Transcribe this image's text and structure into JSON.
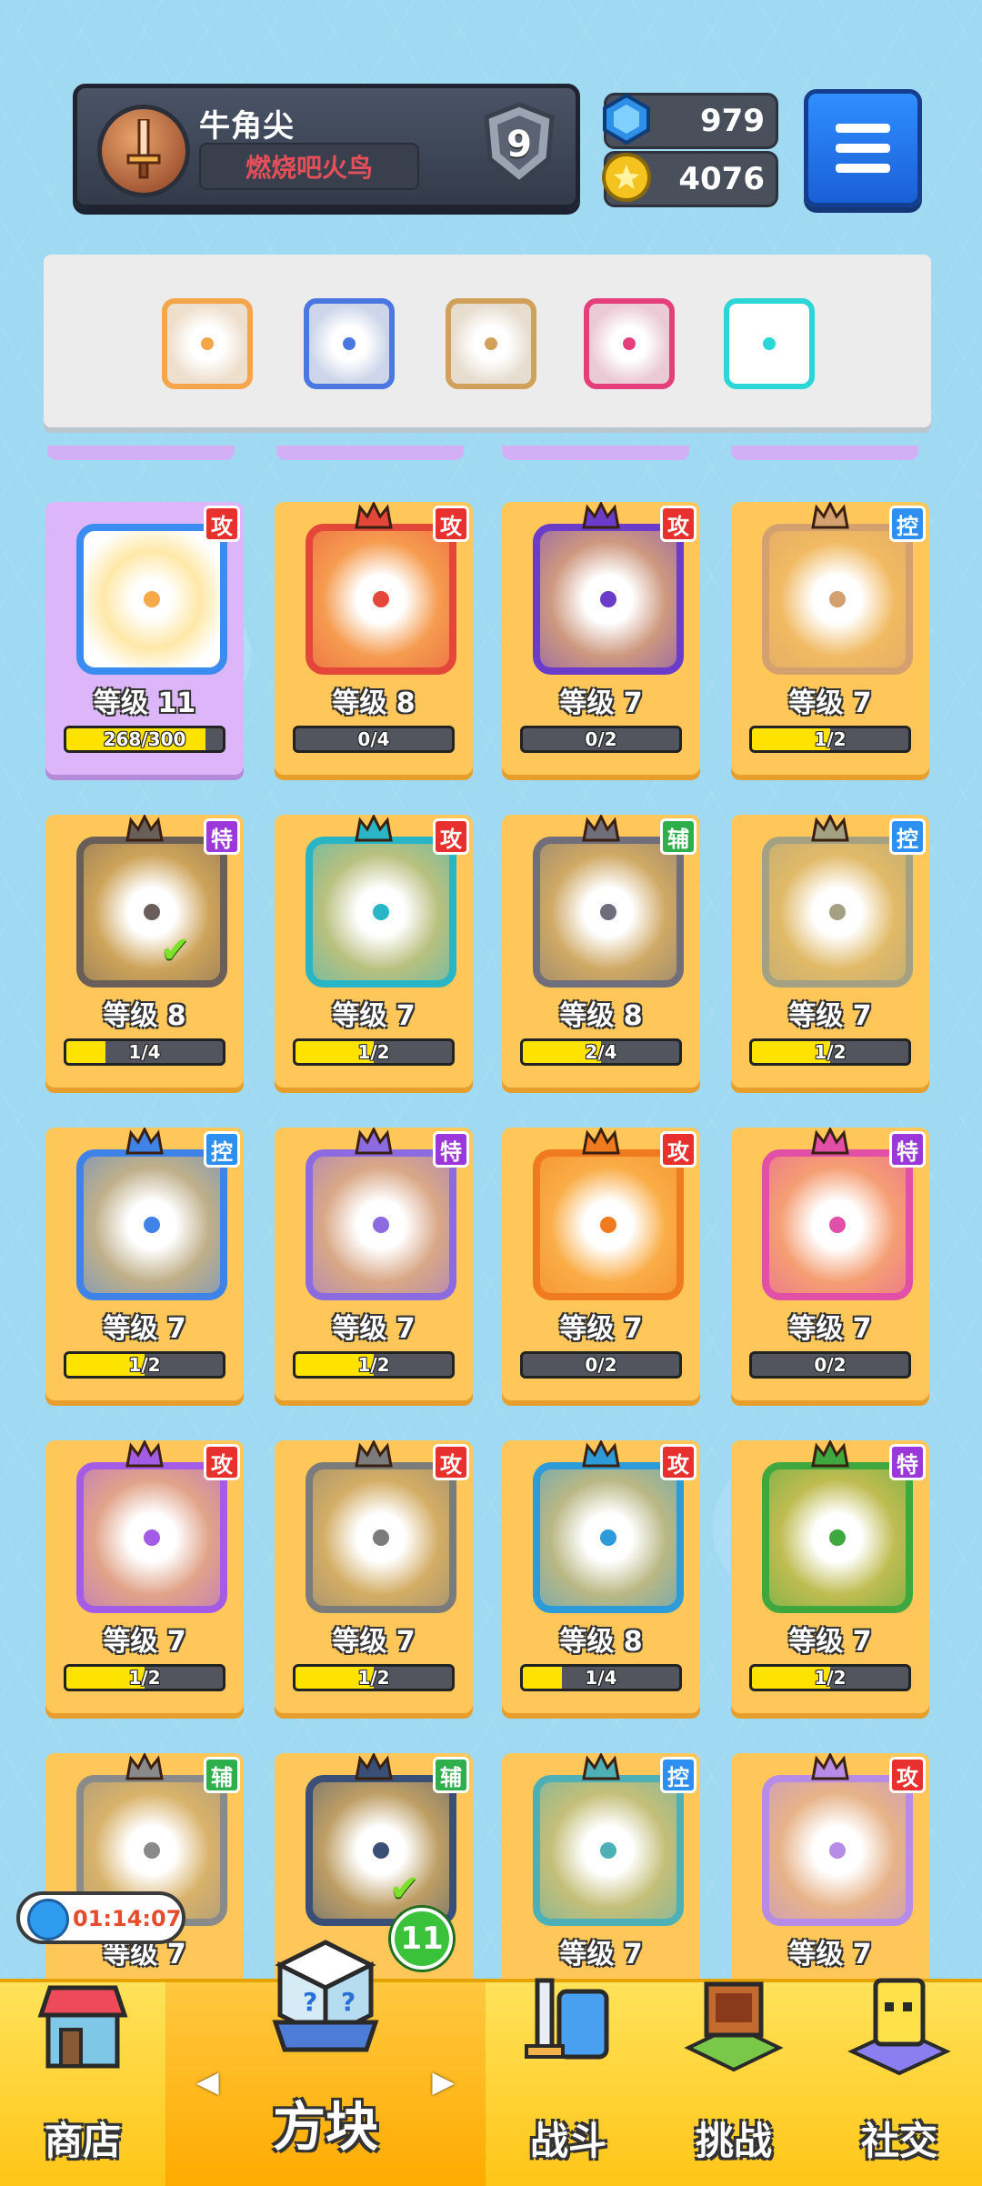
{
  "profile": {
    "name": "牛角尖",
    "title": "燃烧吧火鸟",
    "rank": "9"
  },
  "currency": {
    "gems": "979",
    "coins": "4076"
  },
  "equipped": [
    {
      "icon": "heart-icon",
      "color": "#f5a64a"
    },
    {
      "icon": "moon-icon",
      "color": "#4a78e0"
    },
    {
      "icon": "infinity-icon",
      "color": "#d1a05a"
    },
    {
      "icon": "helix-icon",
      "color": "#e43f7a"
    },
    {
      "icon": "sparkle-icon",
      "color": "#2dd6d6"
    }
  ],
  "cards": [
    {
      "level": "等级 11",
      "progress": "268/300",
      "fill": 0.89,
      "tag": "攻",
      "active": true,
      "color": "#f7a94a"
    },
    {
      "level": "等级 8",
      "progress": "0/4",
      "fill": 0,
      "tag": "攻",
      "color": "#e3473a"
    },
    {
      "level": "等级 7",
      "progress": "0/2",
      "fill": 0,
      "tag": "攻",
      "color": "#6a3cc9"
    },
    {
      "level": "等级 7",
      "progress": "1/2",
      "fill": 0.5,
      "tag": "控",
      "color": "#d4a070"
    },
    {
      "level": "等级 8",
      "progress": "1/4",
      "fill": 0.25,
      "tag": "特",
      "color": "#6a5e58",
      "check": true
    },
    {
      "level": "等级 7",
      "progress": "1/2",
      "fill": 0.5,
      "tag": "攻",
      "color": "#2ab5c7"
    },
    {
      "level": "等级 8",
      "progress": "2/4",
      "fill": 0.5,
      "tag": "辅",
      "color": "#6f6e7a"
    },
    {
      "level": "等级 7",
      "progress": "1/2",
      "fill": 0.5,
      "tag": "控",
      "color": "#a4a183"
    },
    {
      "level": "等级 7",
      "progress": "1/2",
      "fill": 0.5,
      "tag": "控",
      "color": "#3f82e8"
    },
    {
      "level": "等级 7",
      "progress": "1/2",
      "fill": 0.5,
      "tag": "特",
      "color": "#8c6ae0"
    },
    {
      "level": "等级 7",
      "progress": "0/2",
      "fill": 0,
      "tag": "攻",
      "color": "#f07a1e"
    },
    {
      "level": "等级 7",
      "progress": "0/2",
      "fill": 0,
      "tag": "特",
      "color": "#e14fa6"
    },
    {
      "level": "等级 7",
      "progress": "1/2",
      "fill": 0.5,
      "tag": "攻",
      "color": "#a45ce6"
    },
    {
      "level": "等级 7",
      "progress": "1/2",
      "fill": 0.5,
      "tag": "攻",
      "color": "#7b7b7b"
    },
    {
      "level": "等级 8",
      "progress": "1/4",
      "fill": 0.25,
      "tag": "攻",
      "color": "#2e9bd9"
    },
    {
      "level": "等级 7",
      "progress": "1/2",
      "fill": 0.5,
      "tag": "特",
      "color": "#3ea83e"
    },
    {
      "level": "等级 7",
      "progress": "",
      "fill": 0,
      "tag": "辅",
      "color": "#8a8a8a"
    },
    {
      "level": "",
      "progress": "",
      "fill": 0,
      "tag": "辅",
      "color": "#3a4f78",
      "check": true
    },
    {
      "level": "等级 7",
      "progress": "",
      "fill": 0,
      "tag": "控",
      "color": "#4cb0b6"
    },
    {
      "level": "等级 7",
      "progress": "",
      "fill": 0,
      "tag": "攻",
      "color": "#b68ce6"
    }
  ],
  "tagColors": {
    "攻": "#e8302e",
    "控": "#2d8ff0",
    "特": "#9b38d9",
    "辅": "#2fae4c"
  },
  "timer": "01:14:07",
  "nav": {
    "shop": "商店",
    "blocks": "方块",
    "battle": "战斗",
    "challenge": "挑战",
    "social": "社交",
    "badge": "11"
  }
}
